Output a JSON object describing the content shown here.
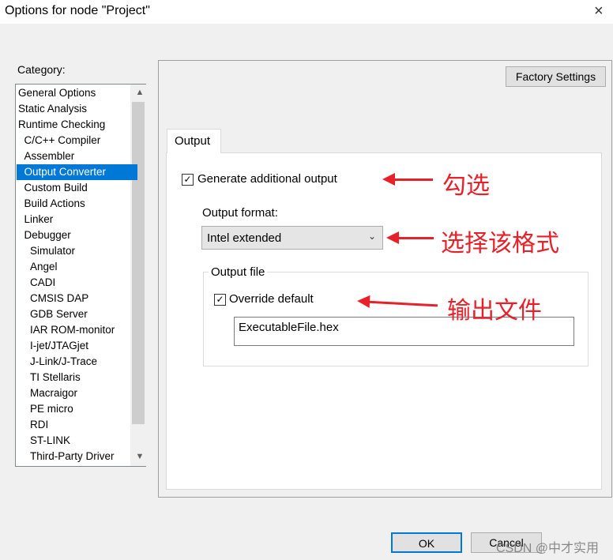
{
  "window": {
    "title": "Options for node \"Project\"",
    "close_icon": "×"
  },
  "category": {
    "label": "Category:",
    "items": [
      "General Options",
      "Static Analysis",
      "Runtime Checking",
      "C/C++ Compiler",
      "Assembler",
      "Output Converter",
      "Custom Build",
      "Build Actions",
      "Linker",
      "Debugger",
      "Simulator",
      "Angel",
      "CADI",
      "CMSIS DAP",
      "GDB Server",
      "IAR ROM-monitor",
      "I-jet/JTAGjet",
      "J-Link/J-Trace",
      "TI Stellaris",
      "Macraigor",
      "PE micro",
      "RDI",
      "ST-LINK",
      "Third-Party Driver"
    ],
    "selected": "Output Converter"
  },
  "factory_settings": "Factory Settings",
  "tab": "Output",
  "generate": {
    "label": "Generate additional output",
    "checked": true
  },
  "format": {
    "label": "Output format:",
    "value": "Intel extended"
  },
  "output_file": {
    "group": "Output file",
    "override_label": "Override default",
    "override_checked": true,
    "filename": "ExecutableFile.hex"
  },
  "annotations": [
    "勾选",
    "选择该格式",
    "输出文件"
  ],
  "buttons": {
    "ok": "OK",
    "cancel": "Cancel"
  },
  "watermark": "CSDN @中才实用",
  "colors": {
    "selection": "#0078d7",
    "annotation": "#e8202a"
  }
}
